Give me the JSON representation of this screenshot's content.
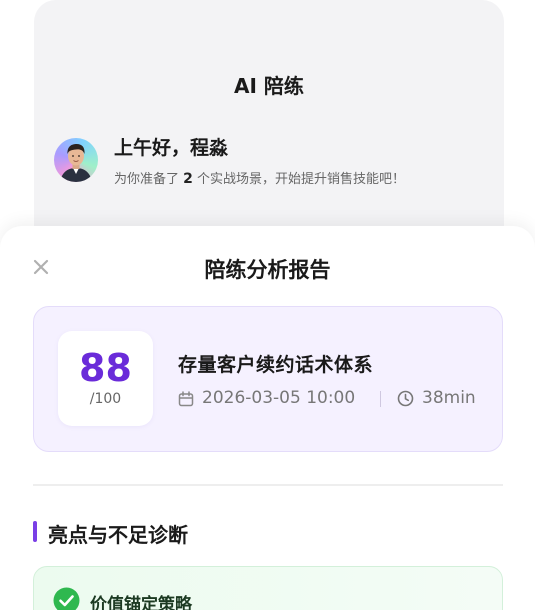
{
  "background_screen": {
    "title": "AI 陪练",
    "greeting": "上午好，程淼",
    "subtitle_prefix": "为你准备了 ",
    "subtitle_count": "2",
    "subtitle_suffix": " 个实战场景，开始提升销售技能吧！"
  },
  "sheet": {
    "title": "陪练分析报告",
    "close_icon": "close-icon"
  },
  "report": {
    "score": "88",
    "score_max": "/100",
    "session_title": "存量客户续约话术体系",
    "date": "2026-03-05 10:00",
    "duration": "38min",
    "accent_color": "#6a2bd9"
  },
  "section": {
    "title": "亮点与不足诊断"
  },
  "items": [
    {
      "title": "价值锚定策略",
      "status": "positive",
      "color": "#2fb84f"
    }
  ]
}
